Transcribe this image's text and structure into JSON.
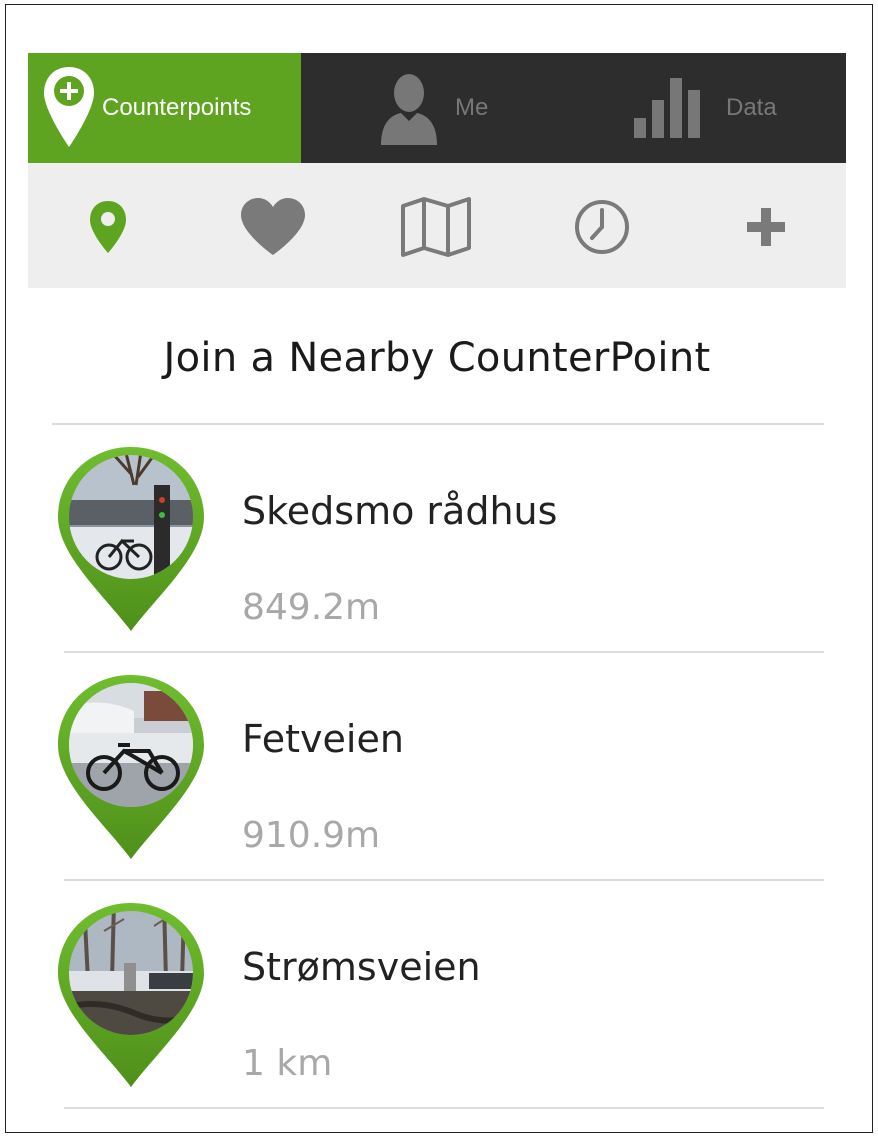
{
  "colors": {
    "accent": "#5fa421",
    "topbar": "#2d2d2d",
    "subbar": "#eeeeee",
    "icon_gray": "#7a7a7a"
  },
  "tabs": [
    {
      "label": "Counterpoints",
      "icon": "add-location-pin-icon",
      "active": true
    },
    {
      "label": "Me",
      "icon": "person-icon",
      "active": false
    },
    {
      "label": "Data",
      "icon": "bar-chart-icon",
      "active": false
    }
  ],
  "toolbar": {
    "icons": [
      "location-pin-icon",
      "heart-icon",
      "map-icon",
      "clock-icon",
      "plus-icon"
    ],
    "active": "location-pin-icon"
  },
  "heading": "Join a Nearby CounterPoint",
  "counterpoints": [
    {
      "name": "Skedsmo rådhus",
      "distance": "849.2m",
      "photo": "bike-counter-snow-photo"
    },
    {
      "name": "Fetveien",
      "distance": "910.9m",
      "photo": "bicycle-in-snow-photo"
    },
    {
      "name": "Strømsveien",
      "distance": "1 km",
      "photo": "trees-parking-photo"
    }
  ]
}
